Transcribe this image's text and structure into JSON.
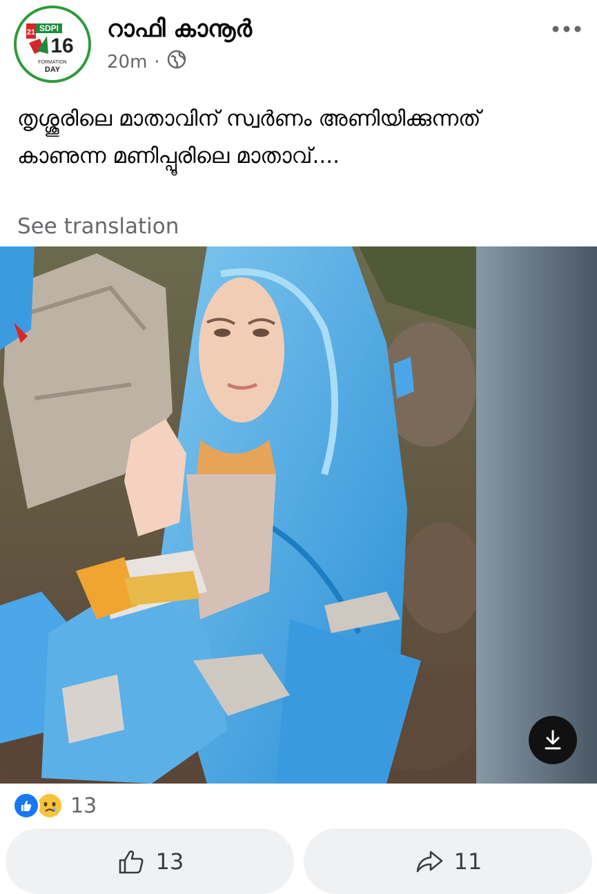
{
  "post": {
    "author": "റാഫി കാനൂർ",
    "time": "20m",
    "separator": "·",
    "privacy_icon": "globe-icon",
    "text": "തൃശ്ശൂരിലെ മാതാവിന് സ്വർണം അണിയിക്കുന്നത് കാണുന്ന മണിപ്പൂരിലെ മാതാവ്....",
    "see_translation": "See translation"
  },
  "avatar_logo": {
    "number_21": "21",
    "brand": "SDPI",
    "number_16": "16",
    "line1": "FORMATION",
    "line2": "DAY"
  },
  "reactions": {
    "count": "13",
    "icons": [
      "like-icon",
      "sad-icon"
    ]
  },
  "actions": {
    "like_count": "13",
    "share_count": "11"
  },
  "colors": {
    "facebook_blue": "#1877f2",
    "avatar_ring": "#2e9a3b",
    "muted_text": "#65676b",
    "button_bg": "#eff1f3"
  }
}
